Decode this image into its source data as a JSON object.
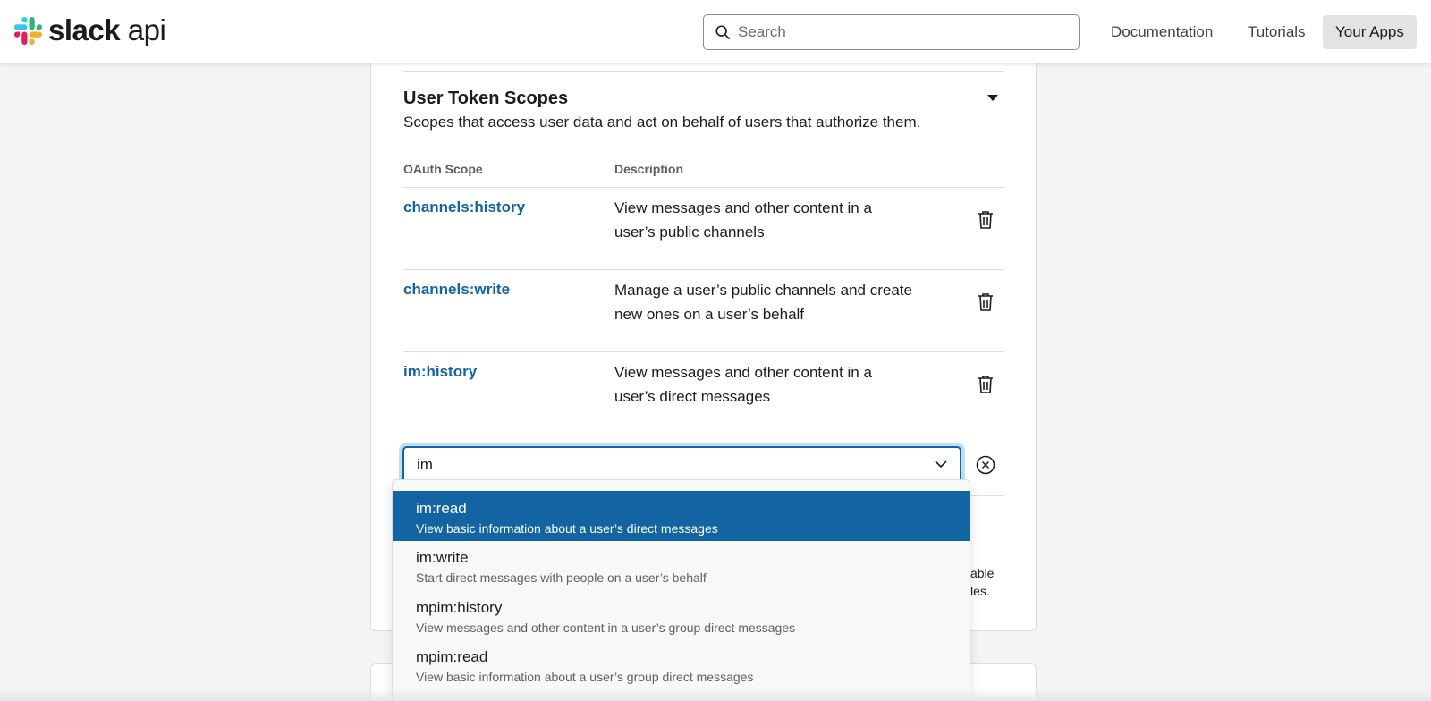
{
  "header": {
    "logo_bold": "slack",
    "logo_light": "api",
    "search_placeholder": "Search",
    "nav": [
      "Documentation",
      "Tutorials",
      "Your Apps"
    ]
  },
  "section": {
    "title": "User Token Scopes",
    "description": "Scopes that access user data and act on behalf of users that authorize them.",
    "columns": [
      "OAuth Scope",
      "Description"
    ]
  },
  "scopes": [
    {
      "name": "channels:history",
      "line1": "View messages and other content in a",
      "line2": "user’s public channels"
    },
    {
      "name": "channels:write",
      "line1": "Manage a user’s public channels and create",
      "line2": "new ones on a user’s behalf"
    },
    {
      "name": "im:history",
      "line1": "View messages and other content in a",
      "line2": "user’s direct messages"
    }
  ],
  "scope_input": {
    "value": "im"
  },
  "dropdown_options": [
    {
      "name": "im:read",
      "desc": "View basic information about a user’s direct messages",
      "selected": true
    },
    {
      "name": "im:write",
      "desc": "Start direct messages with people on a user’s behalf",
      "selected": false
    },
    {
      "name": "mpim:history",
      "desc": "View messages and other content in a user’s group direct messages",
      "selected": false
    },
    {
      "name": "mpim:read",
      "desc": "View basic information about a user’s group direct messages",
      "selected": false
    }
  ],
  "partial_text": [
    "able",
    "les."
  ],
  "colors": {
    "link": "#1264a3",
    "selected": "#1264a3"
  }
}
